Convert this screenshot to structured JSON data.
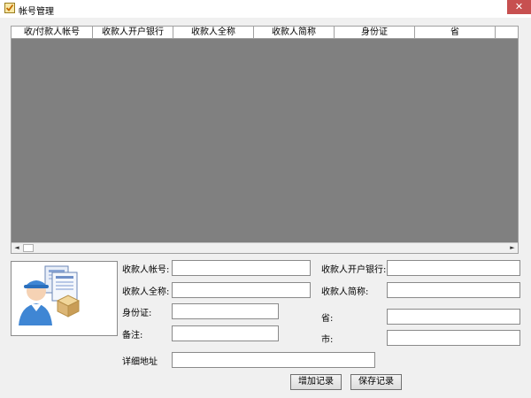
{
  "window": {
    "title": "帐号管理",
    "close_glyph": "✕"
  },
  "grid": {
    "columns": [
      "收/付款人帐号",
      "收款人开户银行",
      "收款人全称",
      "收款人简称",
      "身份证",
      "省"
    ]
  },
  "form": {
    "payee_account_label": "收款人帐号:",
    "payee_fullname_label": "收款人全称:",
    "id_card_label": "身份证:",
    "remark_label": "备注:",
    "bank_label": "收款人开户银行:",
    "short_name_label": "收款人简称:",
    "province_label": "省:",
    "city_label": "市:",
    "address_label": "详细地址",
    "payee_account_value": "",
    "payee_fullname_value": "",
    "id_card_value": "",
    "remark_value": "",
    "bank_value": "",
    "short_name_value": "",
    "province_value": "",
    "city_value": "",
    "address_value": ""
  },
  "buttons": {
    "add_label": "增加记录",
    "save_label": "保存记录"
  },
  "icons": {
    "app": "checkbox-icon",
    "picture": "customer-service-person-icon",
    "scroll_left": "arrow-left-icon",
    "scroll_right": "arrow-right-icon"
  },
  "colors": {
    "grid_background": "#808080",
    "close_button": "#c75050"
  }
}
